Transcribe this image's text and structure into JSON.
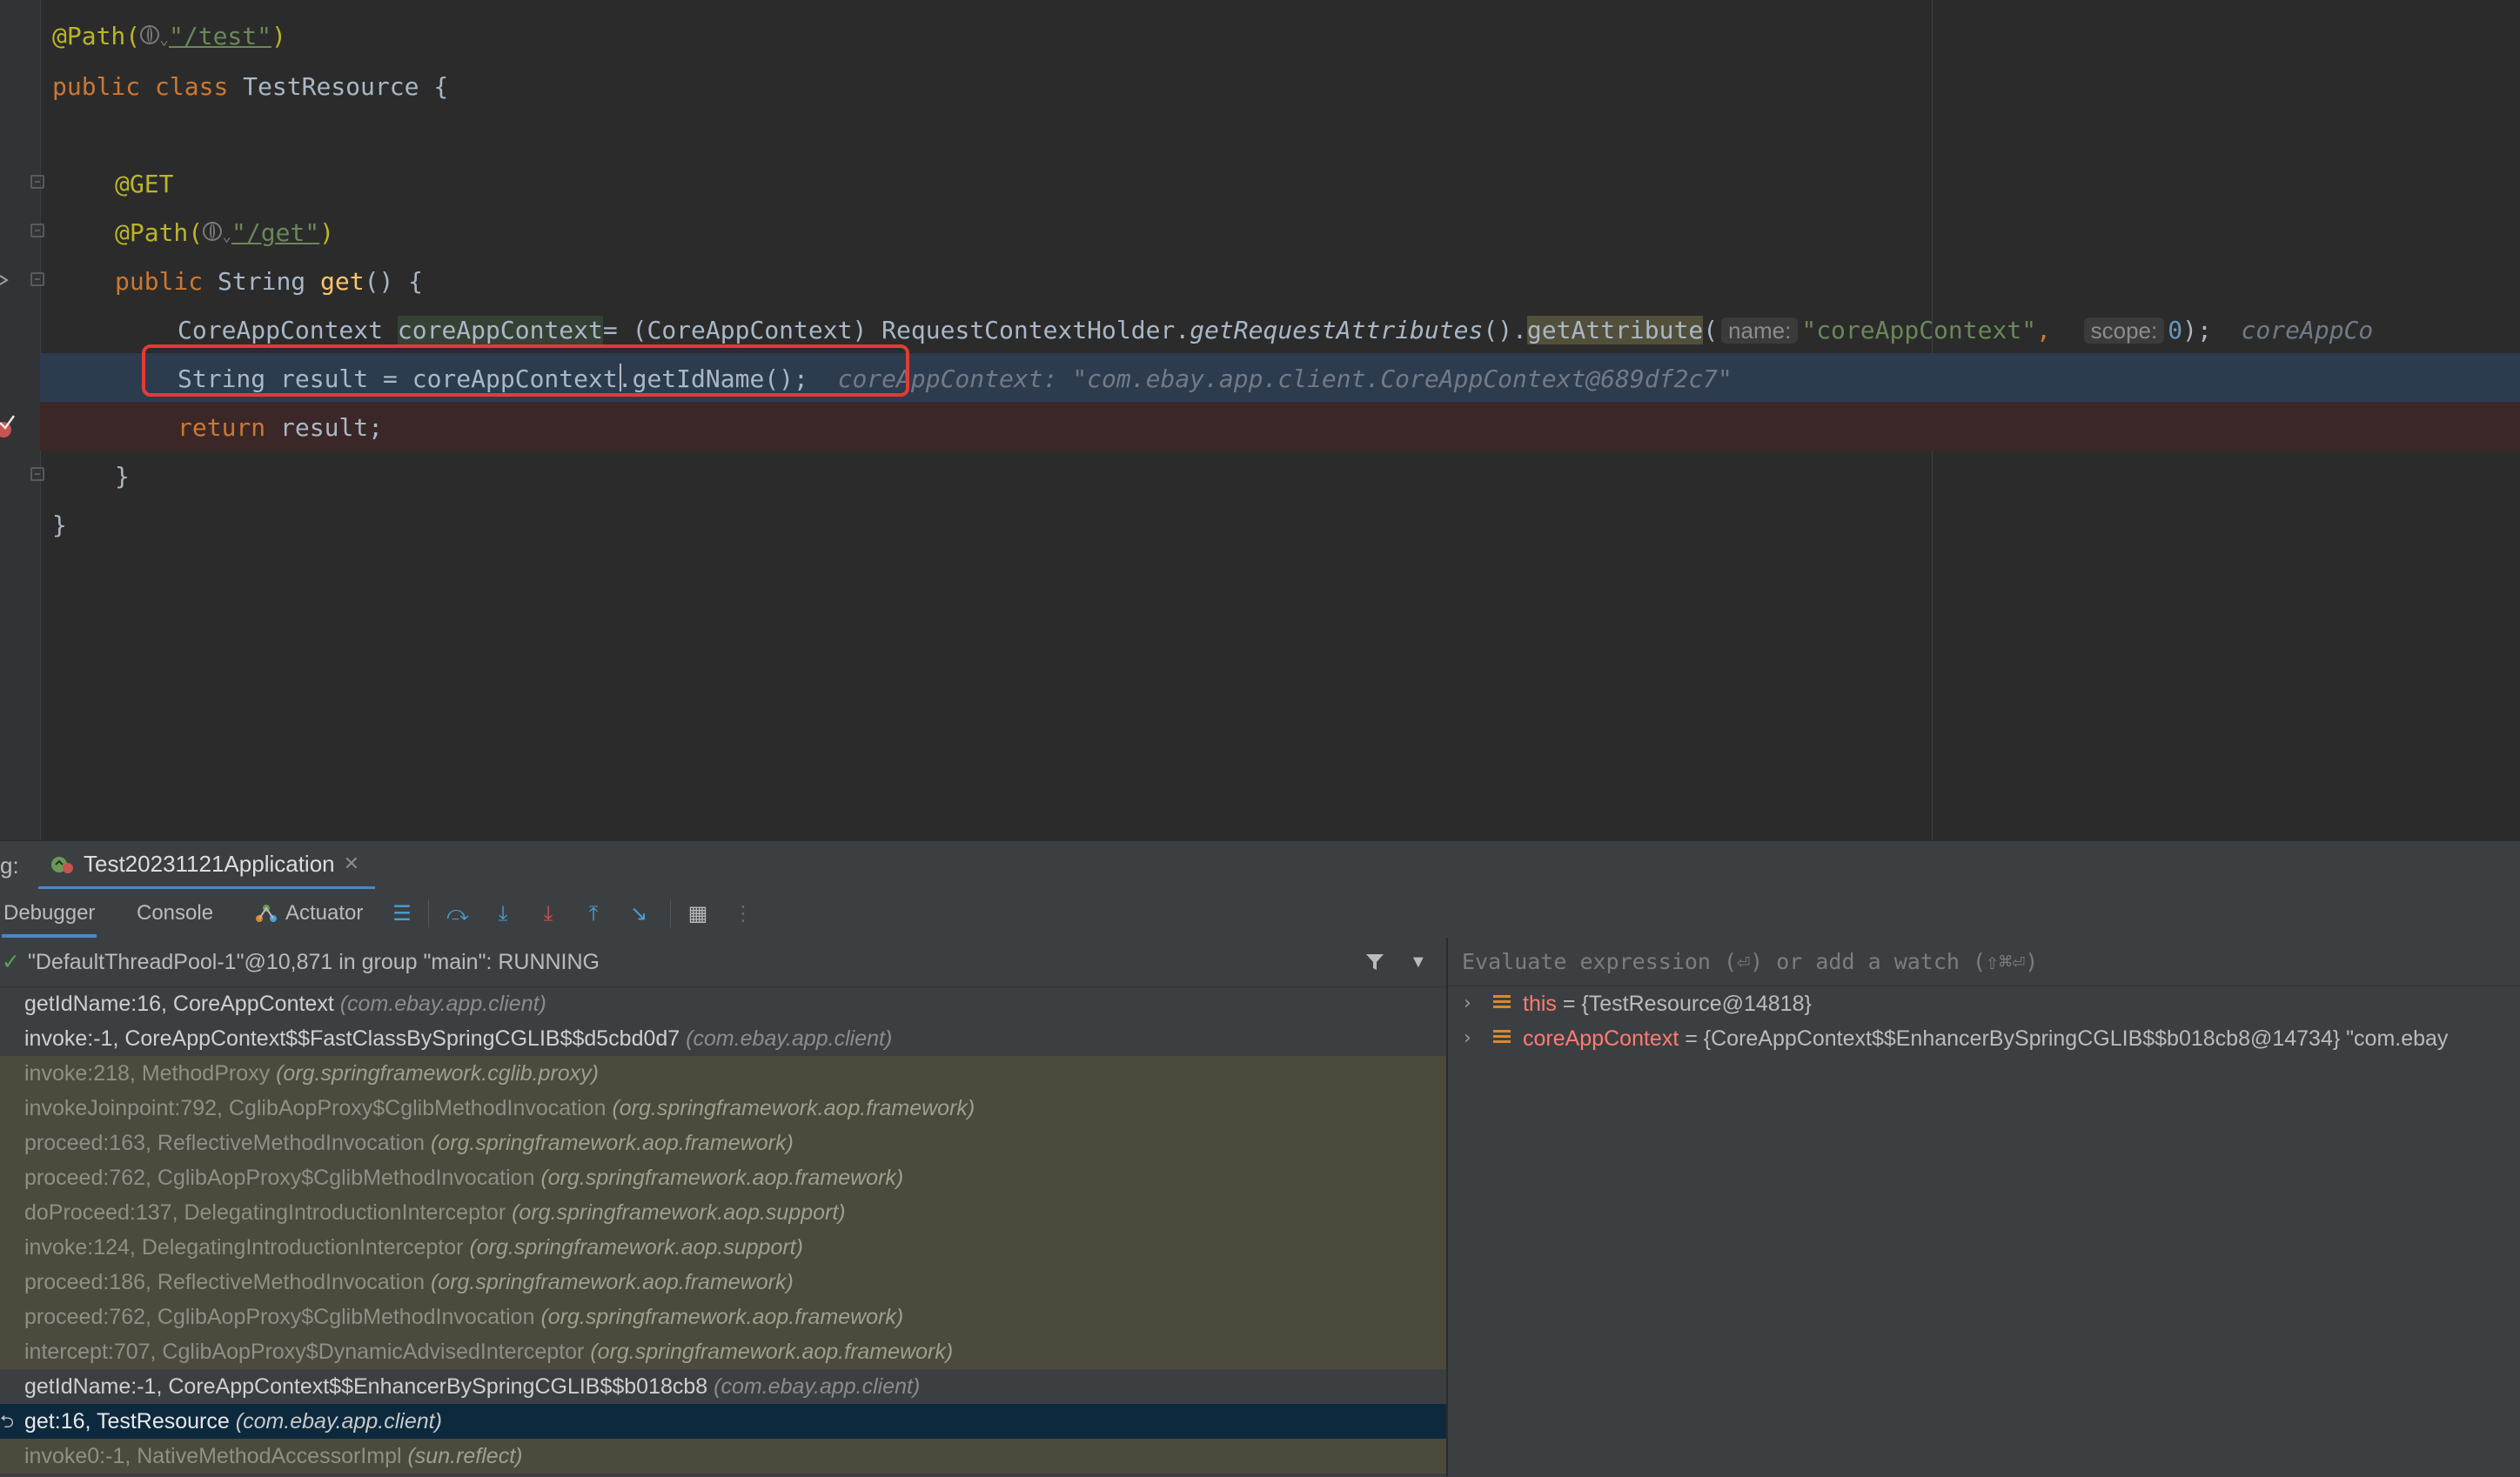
{
  "editor": {
    "lines": {
      "l1_ann": "@Path(",
      "l1_str": "\"/test\"",
      "l1_close": ")",
      "l2_kw1": "public",
      "l2_kw2": "class",
      "l2_name": "TestResource {",
      "l4": "@GET",
      "l5_ann": "@Path(",
      "l5_str": "\"/get\"",
      "l5_close": ")",
      "l6_kw": "public",
      "l6_type": "String",
      "l6_fn": "get",
      "l6_rest": "() {",
      "l7_a": "CoreAppContext ",
      "l7_var": "coreAppContext",
      "l7_b": "= (CoreAppContext) RequestContextHolder.",
      "l7_call": "getRequestAttributes",
      "l7_c": "().",
      "l7_attr": "getAttribute",
      "l7_paren": "(",
      "l7_hint_name": "name:",
      "l7_str": "\"coreAppContext\"",
      "l7_comma": ",",
      "l7_hint_scope": "scope:",
      "l7_num": "0",
      "l7_end": ");",
      "l7_inline": "coreAppCo",
      "l8_code": "String result = coreAppContext.getIdName();",
      "l8_inline": "coreAppContext: \"com.ebay.app.client.CoreAppContext@689df2c7\"",
      "l9_kw": "return",
      "l9_rest": " result;",
      "l10": "}",
      "l11": "}"
    }
  },
  "debug": {
    "label": "g:",
    "run_config": "Test20231121Application",
    "tabs": {
      "debugger": "Debugger",
      "console": "Console",
      "actuator": "Actuator"
    },
    "thread": "\"DefaultThreadPool-1\"@10,871 in group \"main\": RUNNING",
    "frames": [
      {
        "method": "getIdName:16, CoreAppContext",
        "pkg": "(com.ebay.app.client)",
        "kind": "normal"
      },
      {
        "method": "invoke:-1, CoreAppContext$$FastClassBySpringCGLIB$$d5cbd0d7",
        "pkg": "(com.ebay.app.client)",
        "kind": "normal"
      },
      {
        "method": "invoke:218, MethodProxy",
        "pkg": "(org.springframework.cglib.proxy)",
        "kind": "library"
      },
      {
        "method": "invokeJoinpoint:792, CglibAopProxy$CglibMethodInvocation",
        "pkg": "(org.springframework.aop.framework)",
        "kind": "library"
      },
      {
        "method": "proceed:163, ReflectiveMethodInvocation",
        "pkg": "(org.springframework.aop.framework)",
        "kind": "library"
      },
      {
        "method": "proceed:762, CglibAopProxy$CglibMethodInvocation",
        "pkg": "(org.springframework.aop.framework)",
        "kind": "library"
      },
      {
        "method": "doProceed:137, DelegatingIntroductionInterceptor",
        "pkg": "(org.springframework.aop.support)",
        "kind": "library"
      },
      {
        "method": "invoke:124, DelegatingIntroductionInterceptor",
        "pkg": "(org.springframework.aop.support)",
        "kind": "library"
      },
      {
        "method": "proceed:186, ReflectiveMethodInvocation",
        "pkg": "(org.springframework.aop.framework)",
        "kind": "library"
      },
      {
        "method": "proceed:762, CglibAopProxy$CglibMethodInvocation",
        "pkg": "(org.springframework.aop.framework)",
        "kind": "library"
      },
      {
        "method": "intercept:707, CglibAopProxy$DynamicAdvisedInterceptor",
        "pkg": "(org.springframework.aop.framework)",
        "kind": "library"
      },
      {
        "method": "getIdName:-1, CoreAppContext$$EnhancerBySpringCGLIB$$b018cb8",
        "pkg": "(com.ebay.app.client)",
        "kind": "normal"
      },
      {
        "method": "get:16, TestResource",
        "pkg": "(com.ebay.app.client)",
        "kind": "selected"
      },
      {
        "method": "invoke0:-1, NativeMethodAccessorImpl",
        "pkg": "(sun.reflect)",
        "kind": "library"
      }
    ],
    "evaluate_placeholder": "Evaluate expression (⏎) or add a watch (⇧⌘⏎)",
    "variables": [
      {
        "name": "this",
        "value": " = {TestResource@14818}"
      },
      {
        "name": "coreAppContext",
        "value": " = {CoreAppContext$$EnhancerBySpringCGLIB$$b018cb8@14734} \"com.ebay"
      }
    ]
  },
  "colors": {
    "accent": "#4a88c7",
    "highlight_box": "#e53a34",
    "selected_frame": "#0d293e",
    "library_frame": "#4b4a3d"
  }
}
